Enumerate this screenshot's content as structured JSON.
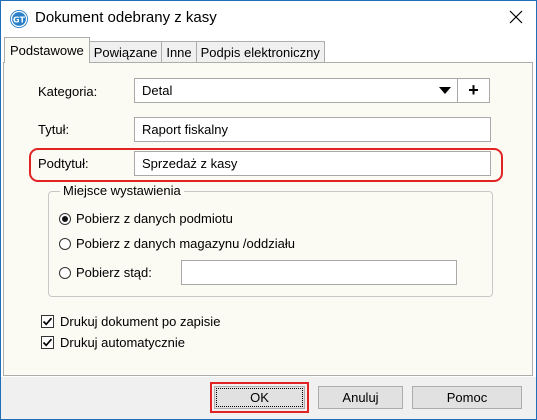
{
  "window": {
    "title": "Dokument odebrany z kasy",
    "app_icon": "app-logo-icon",
    "close_icon": "close-icon"
  },
  "tabs": [
    {
      "label": "Podstawowe",
      "active": true
    },
    {
      "label": "Powiązane",
      "active": false
    },
    {
      "label": "Inne",
      "active": false
    },
    {
      "label": "Podpis elektroniczny",
      "active": false
    }
  ],
  "form": {
    "category_label": "Kategoria:",
    "category_value": "Detal",
    "add_label": "+",
    "title_label": "Tytuł:",
    "title_value": "Raport fiskalny",
    "subtitle_label": "Podtytuł:",
    "subtitle_value": "Sprzedaż z kasy"
  },
  "place": {
    "legend": "Miejsce wystawienia",
    "options": [
      {
        "label": "Pobierz z danych podmiotu",
        "checked": true
      },
      {
        "label": "Pobierz z danych magazynu /oddziału",
        "checked": false
      },
      {
        "label": "Pobierz stąd:",
        "checked": false
      }
    ],
    "custom_value": ""
  },
  "options": {
    "print_after_save": {
      "label": "Drukuj dokument po zapisie",
      "checked": true
    },
    "print_auto": {
      "label": "Drukuj automatycznie",
      "checked": true
    }
  },
  "buttons": {
    "ok": "OK",
    "cancel": "Anuluj",
    "help": "Pomoc"
  },
  "colors": {
    "highlight": "#e02424",
    "panel_bg": "#fbfaf3",
    "footer_bg": "#f0f0f0",
    "window_border": "#1f6fb8"
  }
}
